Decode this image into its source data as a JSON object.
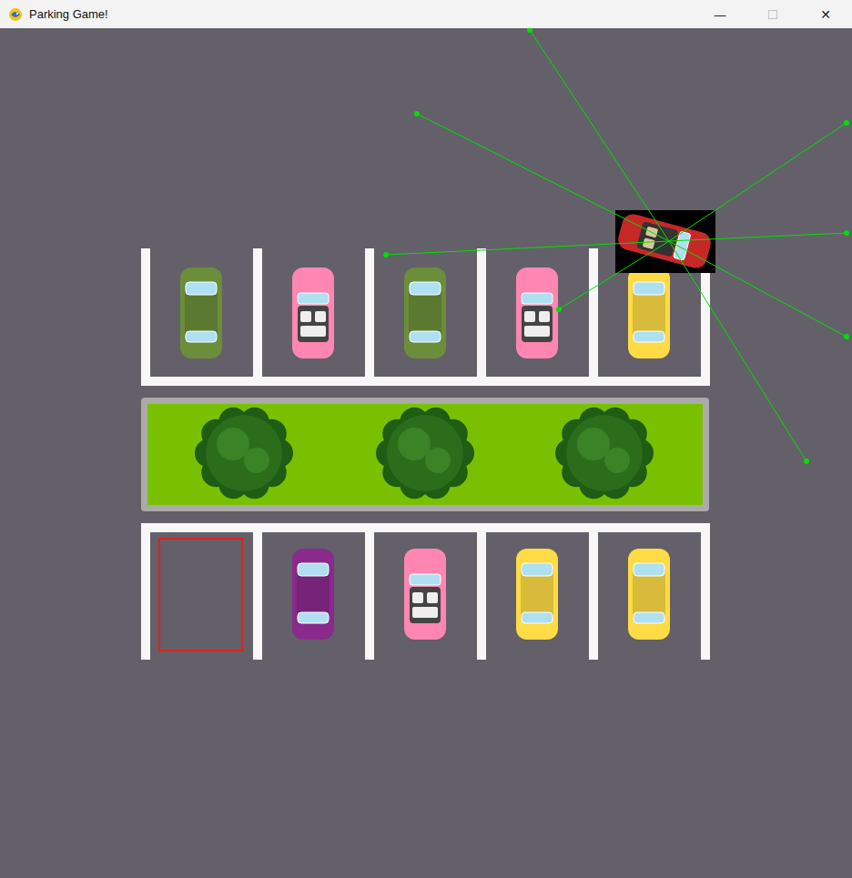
{
  "window": {
    "title": "Parking Game!",
    "controls": [
      "—",
      "☐",
      "✕"
    ]
  },
  "player": {
    "color": "#c62828",
    "sensors_shown": true,
    "sensor_count": 8
  },
  "rows": [
    {
      "name": "top",
      "spots": [
        {
          "occupied": true,
          "target": false,
          "kind": "sedan",
          "color": "#6b8e3a"
        },
        {
          "occupied": true,
          "target": false,
          "kind": "convertible",
          "color": "#ff86b3"
        },
        {
          "occupied": true,
          "target": false,
          "kind": "sedan",
          "color": "#6b8e3a"
        },
        {
          "occupied": true,
          "target": false,
          "kind": "convertible",
          "color": "#ff86b3"
        },
        {
          "occupied": true,
          "target": false,
          "kind": "sedan",
          "color": "#ffdc45"
        }
      ]
    },
    {
      "name": "bottom",
      "spots": [
        {
          "occupied": false,
          "target": true,
          "kind": "none",
          "color": "#e0201e"
        },
        {
          "occupied": true,
          "target": false,
          "kind": "sedan",
          "color": "#8a2a8c"
        },
        {
          "occupied": true,
          "target": false,
          "kind": "convertible",
          "color": "#ff86b3"
        },
        {
          "occupied": true,
          "target": false,
          "kind": "sedan",
          "color": "#ffdc45"
        },
        {
          "occupied": true,
          "target": false,
          "kind": "sedan",
          "color": "#ffdc45"
        }
      ]
    }
  ]
}
